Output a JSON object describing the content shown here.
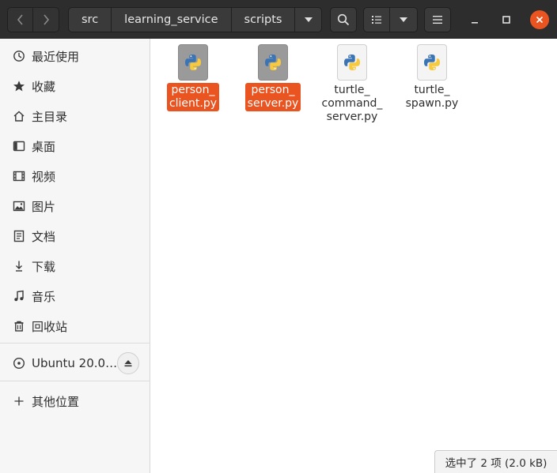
{
  "header": {
    "path": [
      {
        "label": "src"
      },
      {
        "label": "learning_service"
      },
      {
        "label": "scripts"
      }
    ]
  },
  "sidebar": {
    "items": [
      {
        "label": "最近使用",
        "icon": "recent-icon"
      },
      {
        "label": "收藏",
        "icon": "star-icon"
      },
      {
        "label": "主目录",
        "icon": "home-icon"
      },
      {
        "label": "桌面",
        "icon": "desktop-icon"
      },
      {
        "label": "视频",
        "icon": "video-icon"
      },
      {
        "label": "图片",
        "icon": "picture-icon"
      },
      {
        "label": "文档",
        "icon": "document-icon"
      },
      {
        "label": "下载",
        "icon": "download-icon"
      },
      {
        "label": "音乐",
        "icon": "music-icon"
      },
      {
        "label": "回收站",
        "icon": "trash-icon"
      }
    ],
    "devices": [
      {
        "label": "Ubuntu 20.0…",
        "icon": "disc-icon"
      }
    ],
    "other": {
      "label": "其他位置",
      "icon": "plus-icon"
    }
  },
  "files": [
    {
      "name": "person_\nclient.py",
      "selected": true
    },
    {
      "name": "person_\nserver.py",
      "selected": true
    },
    {
      "name": "turtle_\ncommand_\nserver.py",
      "selected": false
    },
    {
      "name": "turtle_\nspawn.py",
      "selected": false
    }
  ],
  "status": {
    "text": "选中了 2 项 (2.0 kB)"
  },
  "colors": {
    "accent": "#e95420",
    "headerbar": "#2d2d2d",
    "sidebar": "#f6f6f6",
    "python_blue": "#3b74b5",
    "python_yellow": "#f7c93e"
  }
}
